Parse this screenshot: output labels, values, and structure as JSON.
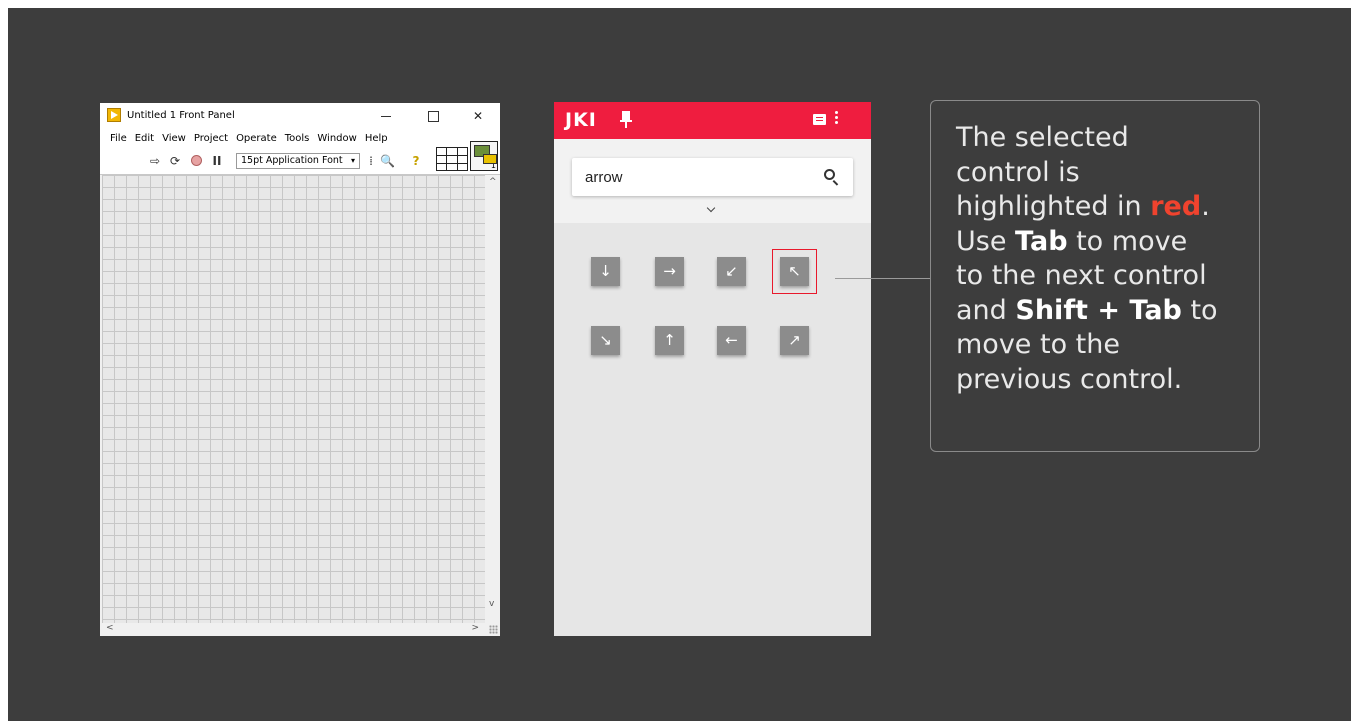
{
  "labview": {
    "title": "Untitled 1 Front Panel",
    "window_controls": {
      "minimize": "—",
      "maximize": "",
      "close": "✕"
    },
    "menu": [
      "File",
      "Edit",
      "View",
      "Project",
      "Operate",
      "Tools",
      "Window",
      "Help"
    ],
    "toolbar": {
      "run_icon": "⇨",
      "run_continuous_icon": "⟳",
      "pause_icon": "II",
      "font_label": "15pt Application Font",
      "font_arrow": "▾",
      "align_icon": "⁞",
      "search_icon": "🔍",
      "help_icon": "?",
      "vi_icon_number": "1"
    },
    "scroll": {
      "up": "^",
      "down": "v",
      "left": "<",
      "right": ">"
    }
  },
  "jki": {
    "logo": "JKI",
    "search": {
      "value": "arrow"
    },
    "buttons": [
      {
        "glyph": "↓",
        "name": "arrow-down"
      },
      {
        "glyph": "→",
        "name": "arrow-right"
      },
      {
        "glyph": "↙",
        "name": "arrow-down-left"
      },
      {
        "glyph": "↖",
        "name": "arrow-up-left",
        "selected": true
      },
      {
        "glyph": "↘",
        "name": "arrow-down-right"
      },
      {
        "glyph": "↑",
        "name": "arrow-up"
      },
      {
        "glyph": "←",
        "name": "arrow-left"
      },
      {
        "glyph": "↗",
        "name": "arrow-up-right"
      }
    ],
    "colors": {
      "header": "#ef1d3f",
      "selection": "#e8192c"
    }
  },
  "callout": {
    "l1": "The selected",
    "l2": "control is",
    "l3_a": "highlighted in ",
    "l3_red": "red",
    "l3_b": ".",
    "l4_a": "Use ",
    "l4_bold": "Tab",
    "l4_b": " to move",
    "l5": "to the next control",
    "l6_a": "and ",
    "l6_bold": "Shift + Tab",
    "l6_b": " to",
    "l7": "move to the",
    "l8": "previous control."
  }
}
